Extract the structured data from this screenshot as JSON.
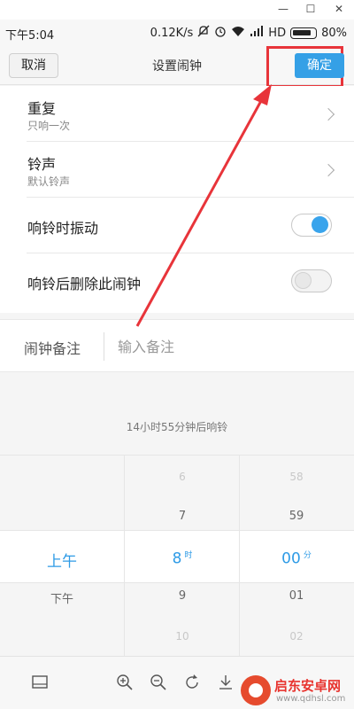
{
  "status_bar": {
    "time": "下午5:04",
    "net_speed": "0.12K/s",
    "network": "HD",
    "battery": "80%"
  },
  "nav": {
    "cancel_label": "取消",
    "title": "设置闹钟",
    "confirm_label": "确定"
  },
  "settings": {
    "repeat": {
      "title": "重复",
      "value": "只响一次"
    },
    "ringtone": {
      "title": "铃声",
      "value": "默认铃声"
    },
    "vibrate": {
      "title": "响铃时振动",
      "on": true
    },
    "delete_after": {
      "title": "响铃后删除此闹钟",
      "on": false
    }
  },
  "note": {
    "label": "闹钟备注",
    "placeholder": "输入备注"
  },
  "countdown": "14小时55分钟后响铃",
  "picker": {
    "ampm": {
      "selected": "上午",
      "below": "下午"
    },
    "hour": {
      "above2": "6",
      "above1": "7",
      "selected": "8",
      "unit": "时",
      "below1": "9",
      "below2": "10"
    },
    "minute": {
      "above2": "58",
      "above1": "59",
      "selected": "00",
      "unit": "分",
      "below1": "01",
      "below2": "02"
    }
  },
  "watermark": {
    "name": "启东安卓网",
    "url": "www.qdhsl.com"
  },
  "colors": {
    "accent": "#35a0e6",
    "highlight": "#e8343a"
  }
}
